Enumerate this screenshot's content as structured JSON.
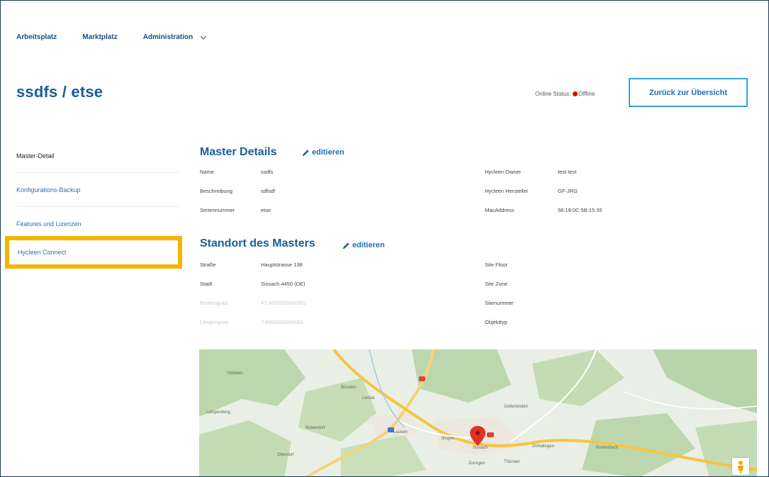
{
  "nav": {
    "items": [
      {
        "label": "Arbeitsplatz"
      },
      {
        "label": "Marktplatz"
      },
      {
        "label": "Administration"
      }
    ]
  },
  "header": {
    "title": "ssdfs / etse",
    "status_label": "Online Status:",
    "status_value": "Offline",
    "status_color": "#e00000",
    "back_button": "Zurück zur Übersicht"
  },
  "sidebar": {
    "items": [
      {
        "label": "Master-Detail"
      },
      {
        "label": "Konfigurations-Backup"
      },
      {
        "label": "Features und Lizenzen"
      },
      {
        "label": "Hycleen Connect"
      }
    ],
    "highlight_color": "#f4b400"
  },
  "master_details": {
    "title": "Master Details",
    "edit_label": "editieren",
    "left": [
      {
        "label": "Name",
        "value": "ssdfs"
      },
      {
        "label": "Beschreibung",
        "value": "sdfsdf"
      },
      {
        "label": "Seriennummer",
        "value": "etse"
      }
    ],
    "right": [
      {
        "label": "Hycleen Owner",
        "value": "test test"
      },
      {
        "label": "Hycleen Hersteller",
        "value": "GF-JRG"
      },
      {
        "label": "MacAddress",
        "value": "56:18:0C:5B:15:35"
      }
    ]
  },
  "location": {
    "title": "Standort des Masters",
    "edit_label": "editieren",
    "left": [
      {
        "label": "Straße",
        "value": "Hauptstrasse 138"
      },
      {
        "label": "Stadt",
        "value": "Sissach 4450 (DE)"
      },
      {
        "label": "Breitengrad",
        "value": "47.4600000000001"
      },
      {
        "label": "Längengrad",
        "value": "7.8800000000001"
      }
    ],
    "right": [
      {
        "label": "Site Floor",
        "value": ""
      },
      {
        "label": "Site Zone",
        "value": ""
      },
      {
        "label": "Sitenummer",
        "value": ""
      },
      {
        "label": "Objekttyp",
        "value": ""
      }
    ]
  },
  "map": {
    "places": [
      "Lausen",
      "Sissach",
      "Itingen",
      "Zunzgen",
      "Liestal",
      "Bubendorf",
      "Oberdorf",
      "Ormalingen",
      "Gelterkinden",
      "Hölstein",
      "Lampenberg",
      "Thürnen",
      "Rickenbach",
      "Böckten"
    ],
    "marker_color": "#e0302a"
  }
}
